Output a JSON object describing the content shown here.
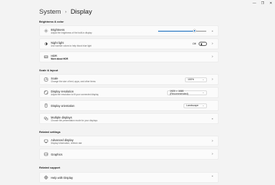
{
  "window": {
    "minimize": "—",
    "maximize": "❐",
    "close": "✕"
  },
  "header": {
    "parent": "System",
    "separator": "›",
    "current": "Display"
  },
  "sections": {
    "brightness_color": "Brightness & color",
    "scale_layout": "Scale & layout",
    "related_settings": "Related settings",
    "related_support": "Related support"
  },
  "brightness": {
    "title": "Brightness",
    "subtitle": "Adjust the brightness of the built-in display",
    "level": 0.75
  },
  "night_light": {
    "title": "Night light",
    "subtitle": "Use warmer colors to help block blue light",
    "state": "Off"
  },
  "hdr": {
    "title": "HDR",
    "subtitle": "More about HDR"
  },
  "scale": {
    "title": "Scale",
    "subtitle": "Change the size of text, apps, and other items",
    "value": "100%"
  },
  "resolution": {
    "title": "Display resolution",
    "subtitle": "Adjust the resolution to fit your connected display",
    "value": "1920 × 1080 (Recommended)"
  },
  "orientation": {
    "title": "Display orientation",
    "value": "Landscape"
  },
  "multiple_displays": {
    "title": "Multiple displays",
    "subtitle": "Choose the presentation mode for your displays"
  },
  "advanced_display": {
    "title": "Advanced display",
    "subtitle": "Display information, refresh rate"
  },
  "graphics": {
    "title": "Graphics"
  },
  "help_display": {
    "title": "Help with Display"
  },
  "chevrons": {
    "right": "›",
    "down": "⌄",
    "up": "⌃"
  }
}
